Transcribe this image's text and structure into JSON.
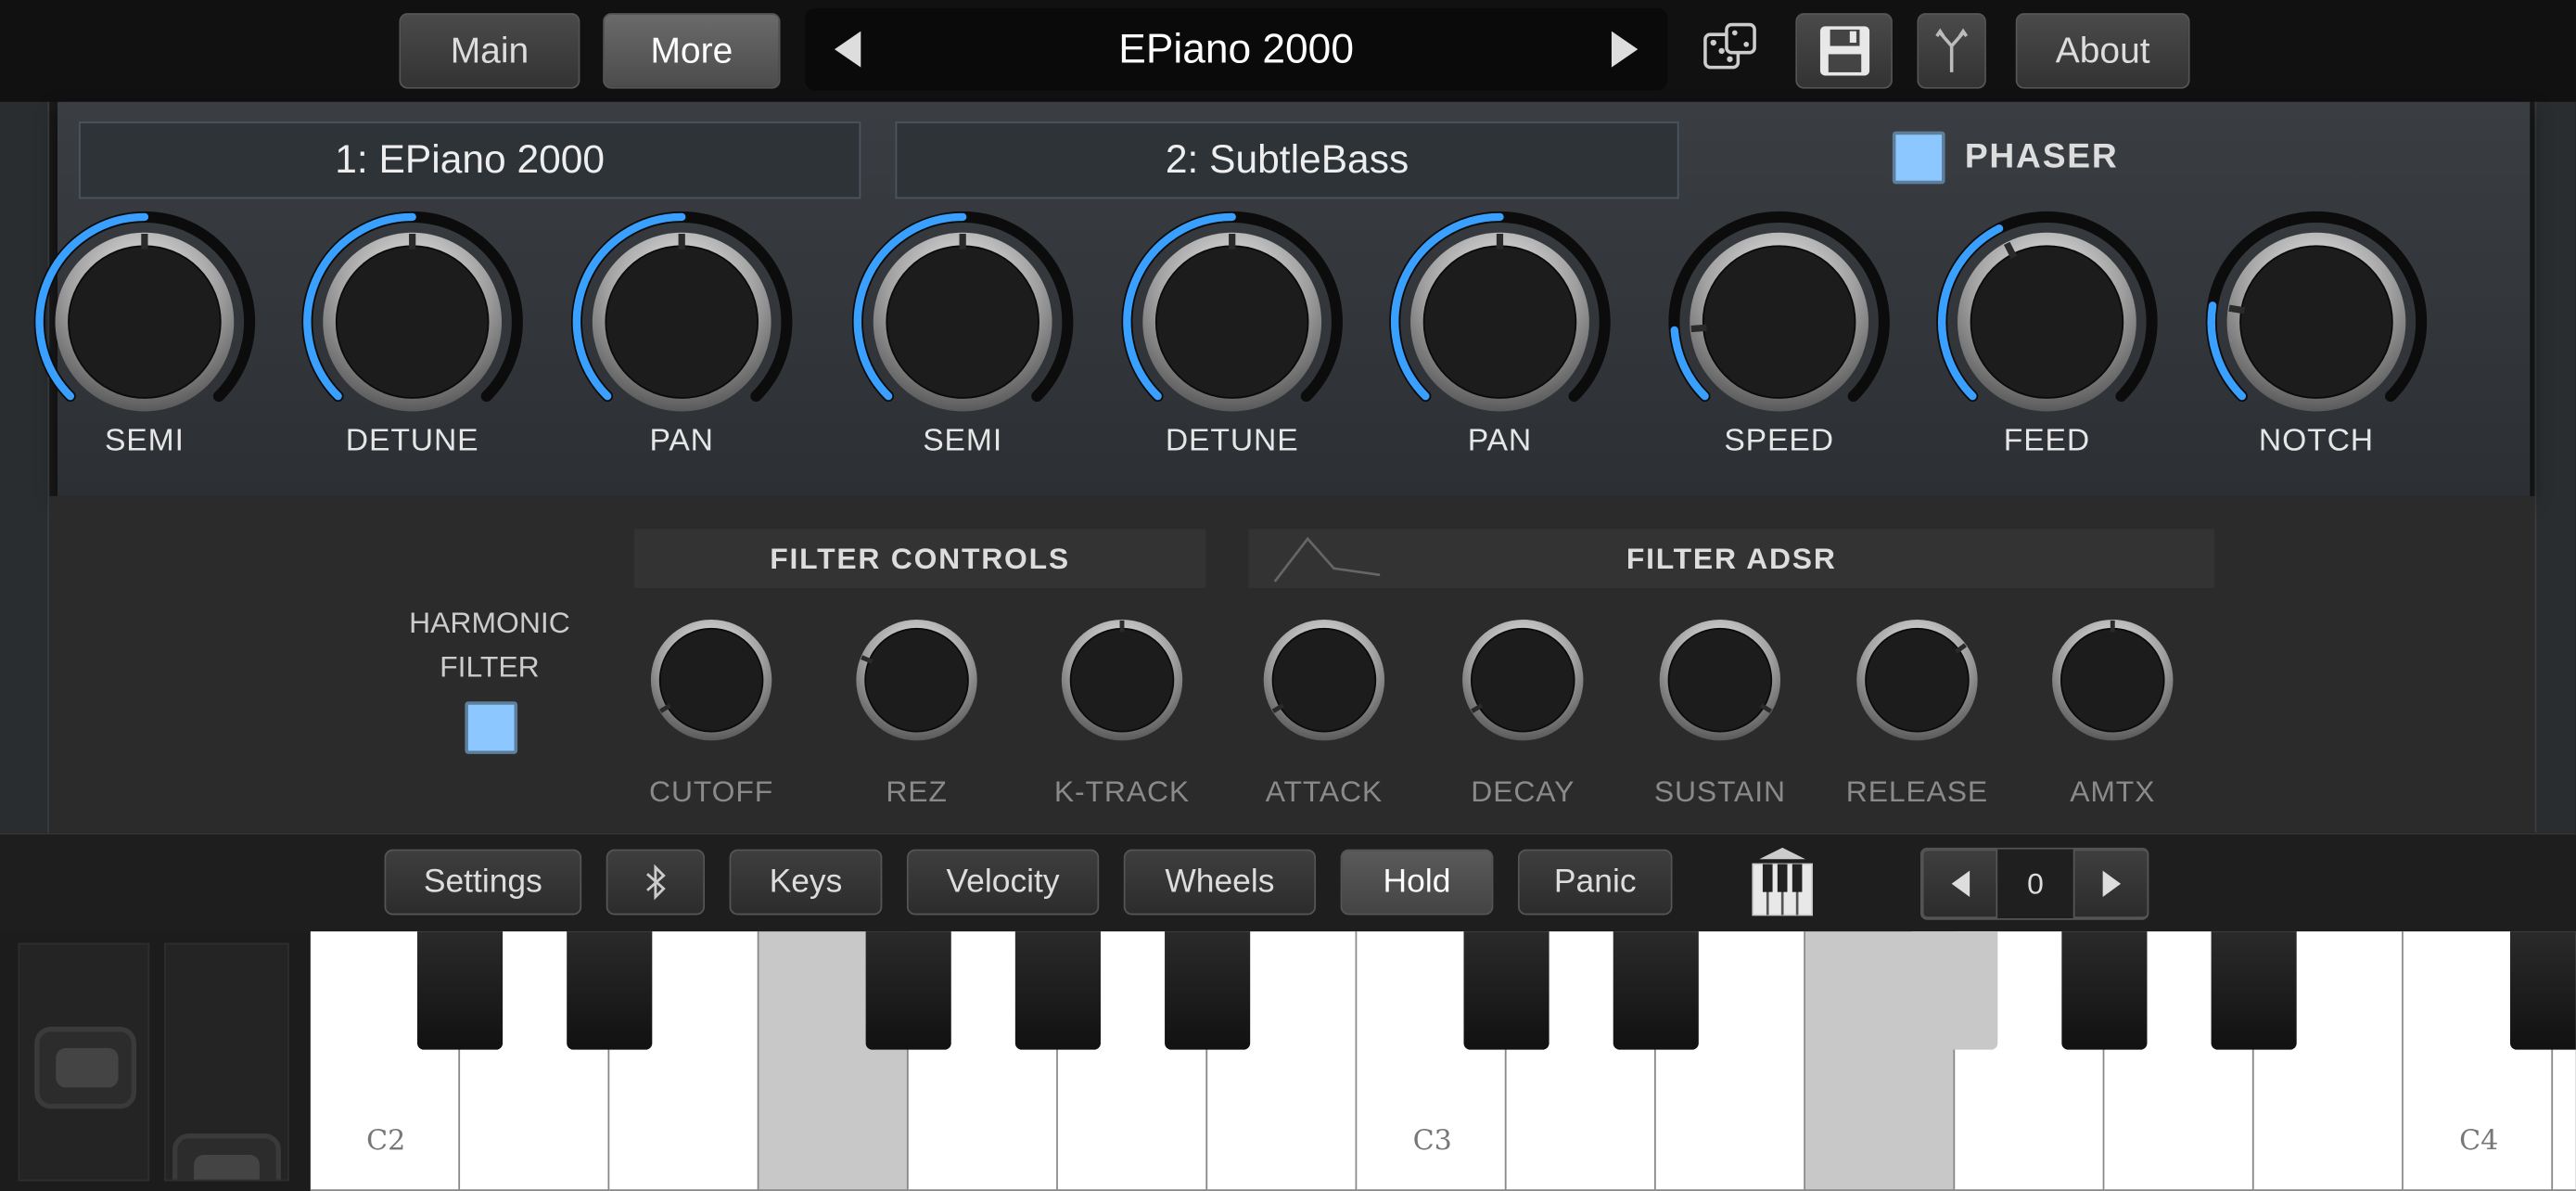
{
  "topbar": {
    "tabs": [
      {
        "label": "Main"
      },
      {
        "label": "More"
      }
    ],
    "preset_name": "EPiano 2000",
    "about_label": "About",
    "icons": [
      "prev-arrow-icon",
      "next-arrow-icon",
      "dice-icon",
      "save-icon",
      "fork-icon"
    ]
  },
  "oscillators": {
    "osc1_name": "1: EPiano 2000",
    "osc2_name": "2: SubtleBass",
    "phaser_label": "PHASER",
    "phaser_enabled": true,
    "knobs": [
      {
        "label": "SEMI",
        "value": 0.5
      },
      {
        "label": "DETUNE",
        "value": 0.5
      },
      {
        "label": "PAN",
        "value": 0.5
      },
      {
        "label": "SEMI",
        "value": 0.5
      },
      {
        "label": "DETUNE",
        "value": 0.5
      },
      {
        "label": "PAN",
        "value": 0.5
      },
      {
        "label": "SPEED",
        "value": 0.15
      },
      {
        "label": "FEED",
        "value": 0.4
      },
      {
        "label": "NOTCH",
        "value": 0.2
      }
    ]
  },
  "filter": {
    "harmonic_filter_line1": "HARMONIC",
    "harmonic_filter_line2": "FILTER",
    "harmonic_enabled": true,
    "controls_title": "FILTER CONTROLS",
    "adsr_title": "FILTER ADSR",
    "knobs": [
      {
        "label": "CUTOFF",
        "value": 0.05
      },
      {
        "label": "REZ",
        "value": 0.25
      },
      {
        "label": "K-TRACK",
        "value": 0.5
      },
      {
        "label": "ATTACK",
        "value": 0.05
      },
      {
        "label": "DECAY",
        "value": 0.05
      },
      {
        "label": "SUSTAIN",
        "value": 0.95
      },
      {
        "label": "RELEASE",
        "value": 0.7
      },
      {
        "label": "AMTX",
        "value": 0.5
      }
    ]
  },
  "bottombar": {
    "buttons": [
      {
        "label": "Settings"
      },
      {
        "label": "Keys"
      },
      {
        "label": "Velocity"
      },
      {
        "label": "Wheels"
      },
      {
        "label": "Hold",
        "active": true
      },
      {
        "label": "Panic"
      }
    ],
    "octave_value": "0",
    "icons": [
      "bluetooth-icon",
      "keyboard-icon",
      "octave-down-icon",
      "octave-up-icon"
    ]
  },
  "keyboard": {
    "labels": [
      "C2",
      "C3",
      "C4"
    ],
    "pressed_notes": [
      "F2",
      "F3",
      "F#3"
    ]
  },
  "colors": {
    "accent_blue": "#3aa0ff",
    "checkbox_blue": "#8cc8ff",
    "background": "#1a1a1a"
  }
}
